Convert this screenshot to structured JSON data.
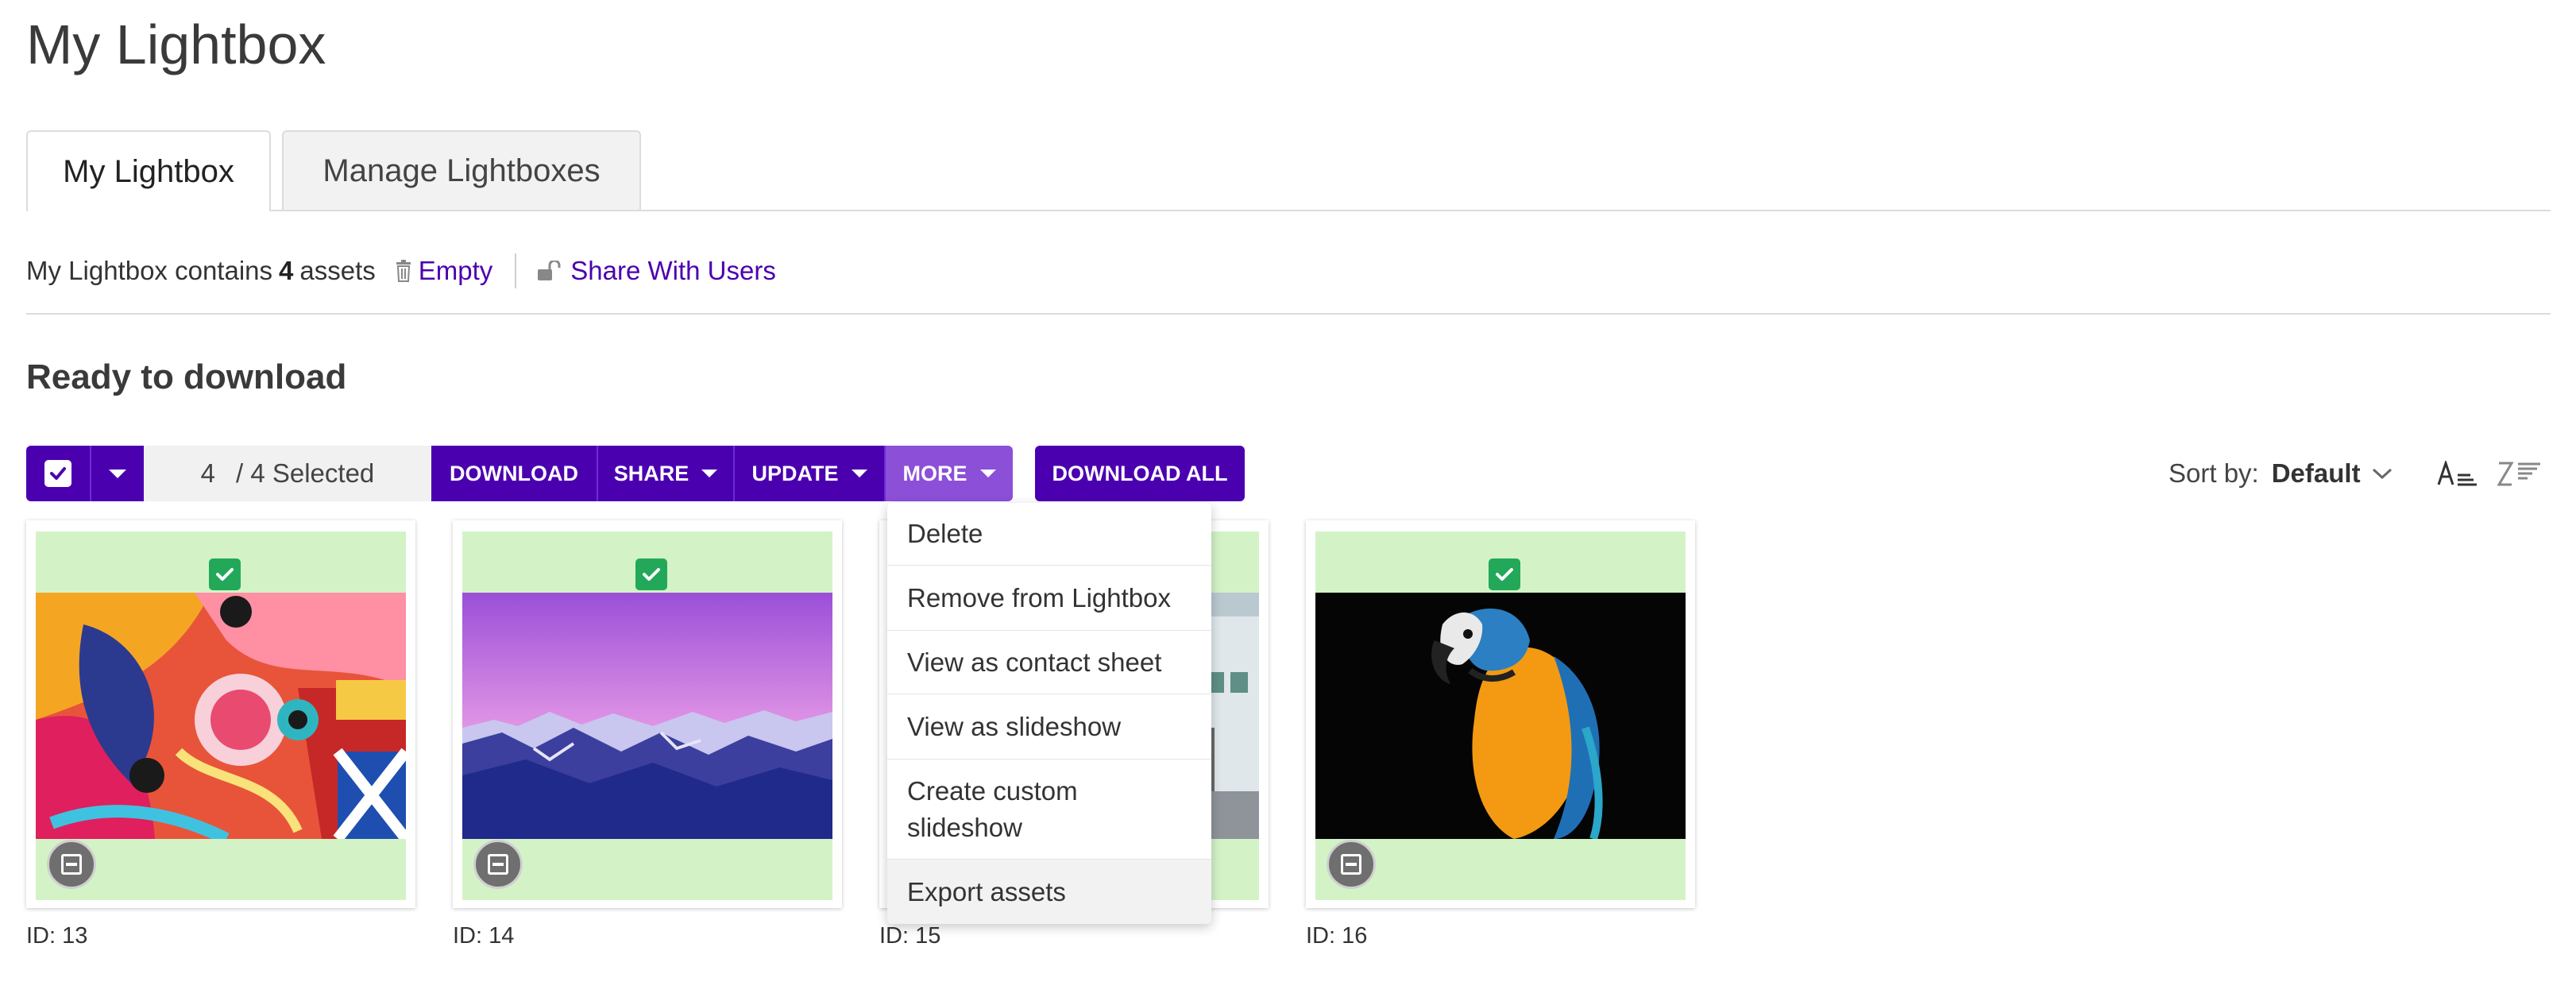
{
  "page_title": "My Lightbox",
  "tabs": [
    {
      "label": "My Lightbox",
      "active": true
    },
    {
      "label": "Manage Lightboxes",
      "active": false
    }
  ],
  "info": {
    "prefix": "My Lightbox contains",
    "count": "4",
    "suffix": "assets",
    "empty_label": "Empty",
    "share_label": "Share With Users"
  },
  "section_title": "Ready to download",
  "toolbar": {
    "selected_count": "4",
    "selected_suffix": "/ 4 Selected",
    "download_label": "DOWNLOAD",
    "share_label": "SHARE",
    "update_label": "UPDATE",
    "more_label": "MORE",
    "download_all_label": "DOWNLOAD ALL"
  },
  "sort": {
    "label": "Sort by:",
    "value": "Default"
  },
  "more_menu": {
    "items": [
      "Delete",
      "Remove from Lightbox",
      "View as contact sheet",
      "View as slideshow",
      "Create custom slideshow",
      "Export assets"
    ],
    "highlighted": "Export assets"
  },
  "assets": [
    {
      "id_label": "ID: 13",
      "selected": true,
      "image": "colorful-pattern-art"
    },
    {
      "id_label": "ID: 14",
      "selected": true,
      "image": "purple-mountain-range"
    },
    {
      "id_label": "ID: 15",
      "selected": true,
      "image": "building-street"
    },
    {
      "id_label": "ID: 16",
      "selected": true,
      "image": "macaw-parrot"
    }
  ],
  "colors": {
    "primary": "#4b00b0",
    "more_active": "#8c4fd8",
    "selected_bg": "#d3f3c7",
    "check_green": "#23a85a"
  }
}
